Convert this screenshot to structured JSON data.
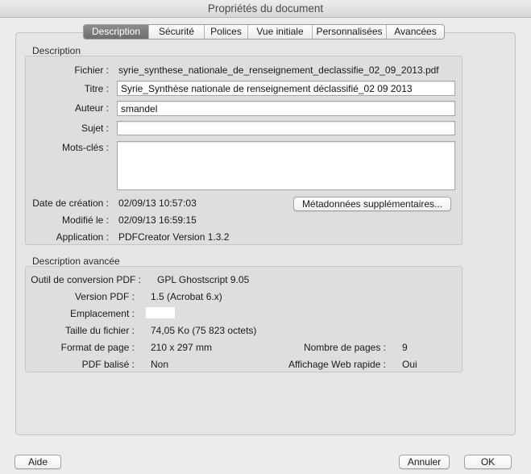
{
  "window": {
    "title": "Propriétés du document"
  },
  "tabs": [
    {
      "label": "Description",
      "active": true
    },
    {
      "label": "Sécurité",
      "active": false
    },
    {
      "label": "Polices",
      "active": false
    },
    {
      "label": "Vue initiale",
      "active": false
    },
    {
      "label": "Personnalisées",
      "active": false
    },
    {
      "label": "Avancées",
      "active": false
    }
  ],
  "description": {
    "section_title": "Description",
    "file_label": "Fichier :",
    "file_value": "syrie_synthese_nationale_de_renseignement_declassifie_02_09_2013.pdf",
    "title_label": "Titre :",
    "title_value": "Syrie_Synthèse nationale de renseignement déclassifié_02 09 2013",
    "author_label": "Auteur :",
    "author_value": "smandel",
    "subject_label": "Sujet :",
    "subject_value": "",
    "keywords_label": "Mots-clés :",
    "keywords_value": "",
    "created_label": "Date de création :",
    "created_value": "02/09/13 10:57:03",
    "modified_label": "Modifié le :",
    "modified_value": "02/09/13 16:59:15",
    "application_label": "Application :",
    "application_value": "PDFCreator Version 1.3.2",
    "metadata_button": "Métadonnées supplémentaires..."
  },
  "advanced": {
    "section_title": "Description avancée",
    "producer_label": "Outil de conversion PDF :",
    "producer_value": "GPL Ghostscript 9.05",
    "version_label": "Version PDF :",
    "version_value": "1.5 (Acrobat 6.x)",
    "location_label": "Emplacement :",
    "location_value": "",
    "filesize_label": "Taille du fichier :",
    "filesize_value": "74,05 Ko (75 823 octets)",
    "pagesize_label": "Format de page :",
    "pagesize_value": "210 x 297 mm",
    "pagecount_label": "Nombre de pages :",
    "pagecount_value": "9",
    "tagged_label": "PDF balisé :",
    "tagged_value": "Non",
    "fastweb_label": "Affichage Web rapide :",
    "fastweb_value": "Oui"
  },
  "footer": {
    "help_button": "Aide",
    "cancel_button": "Annuler",
    "ok_button": "OK"
  }
}
